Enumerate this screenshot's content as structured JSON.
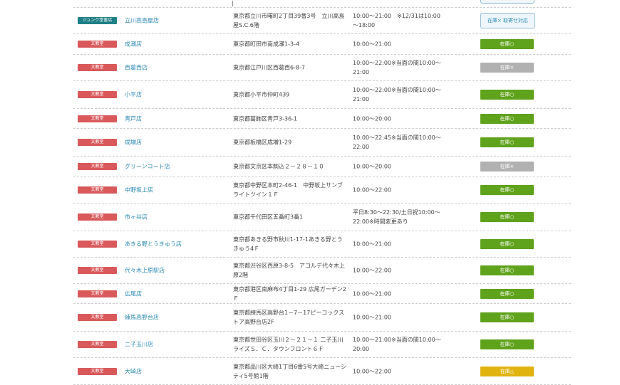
{
  "rows": [
    {
      "tag": "ジュンク堂書店",
      "tag_color": "teal",
      "name": "立川高島屋店",
      "address": "東京都立川市曙町2丁目39番3号　立川高島屋S.C.6階",
      "hours": "10:00～21:00　※12/31は10:00～18:00",
      "status": "在庫× 取寄せ対応",
      "status_color": "outline"
    },
    {
      "tag": "文教堂",
      "tag_color": "red",
      "name": "成瀬店",
      "address": "東京都町田市南成瀬1-3-4",
      "hours": "10:00～21:00",
      "status": "在庫○",
      "status_color": "green"
    },
    {
      "tag": "文教堂",
      "tag_color": "red",
      "name": "西葛西店",
      "address": "東京都江戸川区西葛西6-8-7",
      "hours": "10:00～22:00※当面の間10:00～21:00",
      "status": "在庫×",
      "status_color": "gray"
    },
    {
      "tag": "文教堂",
      "tag_color": "red",
      "name": "小平店",
      "address": "東京都小平市仲町439",
      "hours": "10:00～22:00※当面の間10:00～21:00",
      "status": "在庫○",
      "status_color": "green"
    },
    {
      "tag": "文教堂",
      "tag_color": "red",
      "name": "青戸店",
      "address": "東京都葛飾区青戸3-36-1",
      "hours": "10:00～20:00",
      "status": "在庫○",
      "status_color": "green"
    },
    {
      "tag": "文教堂",
      "tag_color": "red",
      "name": "成増店",
      "address": "東京都板橋区成増1-29",
      "hours": "10:00～22:45※当面の間10:00～22:00",
      "status": "在庫○",
      "status_color": "green"
    },
    {
      "tag": "文教堂",
      "tag_color": "red",
      "name": "グリーンコート店",
      "address": "東京都文京区本駒込２－２８－１０",
      "hours": "10:00～20:00",
      "status": "在庫×",
      "status_color": "gray"
    },
    {
      "tag": "文教堂",
      "tag_color": "red",
      "name": "中野坂上店",
      "address": "東京都中野区本町2-46-1　中野坂上サンブライトツイン１Ｆ",
      "hours": "10:00～22:00",
      "status": "在庫○",
      "status_color": "green"
    },
    {
      "tag": "文教堂",
      "tag_color": "red",
      "name": "市ヶ谷店",
      "address": "東京都千代田区五番町3番1",
      "hours": "平日8:30～22:30/土日祝10:00～22:00※時間変更あり",
      "status": "在庫○",
      "status_color": "green"
    },
    {
      "tag": "文教堂",
      "tag_color": "red",
      "name": "あきる野とうきゅう店",
      "address": "東京都あきる野市秋川1-17-1あきる野とうきゅう4Ｆ",
      "hours": "10:00～21:00",
      "status": "在庫○",
      "status_color": "green"
    },
    {
      "tag": "文教堂",
      "tag_color": "red",
      "name": "代々木上原駅店",
      "address": "東京都渋谷区西原3-8-5　アコルデ代々木上原2階",
      "hours": "10:00～22:00",
      "status": "在庫○",
      "status_color": "green"
    },
    {
      "tag": "文教堂",
      "tag_color": "red",
      "name": "広尾店",
      "address": "東京都港区南麻布4丁目1-29 広尾ガーデン2Ｆ",
      "hours": "10:00～21:00",
      "status": "在庫○",
      "status_color": "green"
    },
    {
      "tag": "文教堂",
      "tag_color": "red",
      "name": "練馬高野台店",
      "address": "東京都練馬区高野台1－7－17ピーコックストア高野台店2F",
      "hours": "10:00～21:00",
      "status": "在庫○",
      "status_color": "green"
    },
    {
      "tag": "文教堂",
      "tag_color": "red",
      "name": "二子玉川店",
      "address": "東京都世田谷区玉川２－２１－１ 二子玉川ライズＳ．Ｃ．タウンフロント６Ｆ",
      "hours": "10:00～21:00※当面の間10:00～20:00",
      "status": "在庫○",
      "status_color": "green"
    },
    {
      "tag": "文教堂",
      "tag_color": "red",
      "name": "大崎店",
      "address": "東京都品川区大崎1丁目6番5号大崎ニューシティ5号館1階",
      "hours": "10:00～22:00",
      "status": "在庫△",
      "status_color": "yellow"
    }
  ]
}
